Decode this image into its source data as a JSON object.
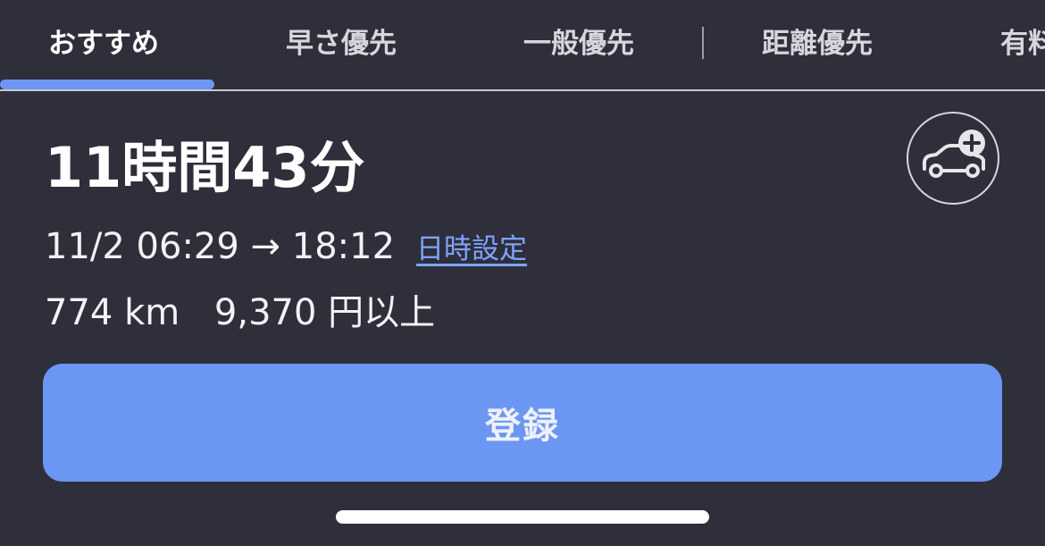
{
  "tabs": [
    {
      "label": "おすすめ",
      "active": true
    },
    {
      "label": "早さ優先",
      "active": false
    },
    {
      "label": "一般優先",
      "active": false
    },
    {
      "label": "距離優先",
      "active": false
    },
    {
      "label": "有料",
      "active": false
    }
  ],
  "route": {
    "duration": "11時間43分",
    "time_range": "11/2 06:29 → 18:12",
    "datetime_link": "日時設定",
    "distance": "774 km",
    "cost": "9,370 円以上"
  },
  "register_button": {
    "label": "登録"
  },
  "icons": {
    "car_add": "car-plus-icon"
  },
  "colors": {
    "background": "#2f2e3b",
    "accent": "#6c96f3",
    "link": "#7ea4ff"
  }
}
